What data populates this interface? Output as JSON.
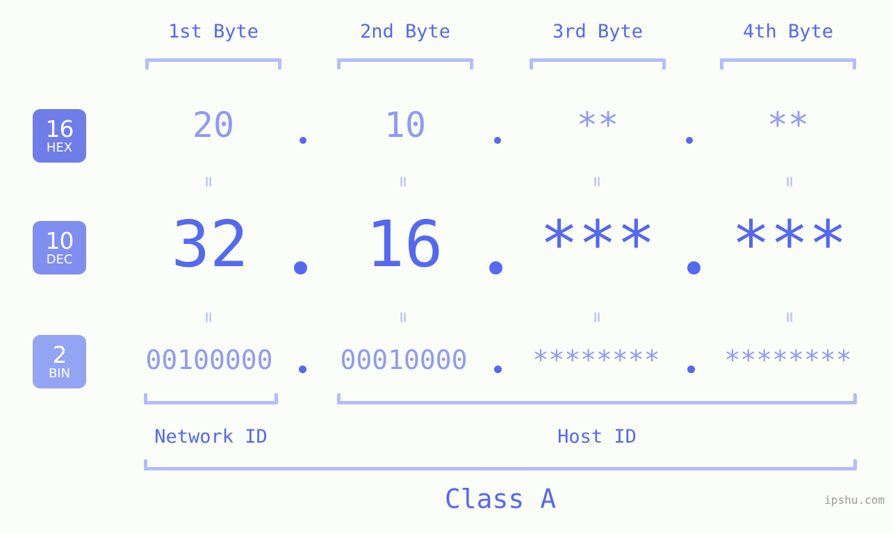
{
  "background_color": "#fbfdf8",
  "accent_strong": "#5468f0",
  "accent_mid": "#8e9bf4",
  "accent_light": "#b3bdfb",
  "byte_headers": [
    {
      "label": "1st Byte"
    },
    {
      "label": "2nd Byte"
    },
    {
      "label": "3rd Byte"
    },
    {
      "label": "4th Byte"
    }
  ],
  "bases": [
    {
      "num": "16",
      "label": "HEX",
      "color": "#6f7de9"
    },
    {
      "num": "10",
      "label": "DEC",
      "color": "#808ef0"
    },
    {
      "num": "2",
      "label": "BIN",
      "color": "#93a4f4"
    }
  ],
  "rows": {
    "hex": {
      "values": [
        "20",
        "10",
        "**",
        "**"
      ],
      "separator": "."
    },
    "dec": {
      "values": [
        "32",
        "16",
        "***",
        "***"
      ],
      "separator": "."
    },
    "bin": {
      "values": [
        "00100000",
        "00010000",
        "********",
        "********"
      ],
      "separator": "."
    }
  },
  "equals_mark": "=",
  "segments": {
    "network_id": "Network ID",
    "host_id": "Host ID"
  },
  "class_label": "Class A",
  "watermark": "ipshu.com"
}
